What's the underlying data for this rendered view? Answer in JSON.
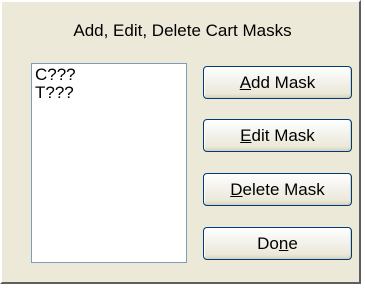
{
  "dialog": {
    "title": "Add, Edit, Delete Cart Masks"
  },
  "mask_list": {
    "items": [
      "C???",
      "T???"
    ]
  },
  "buttons": {
    "add": {
      "mnemonic": "A",
      "rest": "dd Mask"
    },
    "edit": {
      "mnemonic": "E",
      "rest": "dit Mask"
    },
    "delete": {
      "mnemonic": "D",
      "rest": "elete Mask"
    },
    "done": {
      "before": "Do",
      "mnemonic": "n",
      "after": "e"
    }
  }
}
